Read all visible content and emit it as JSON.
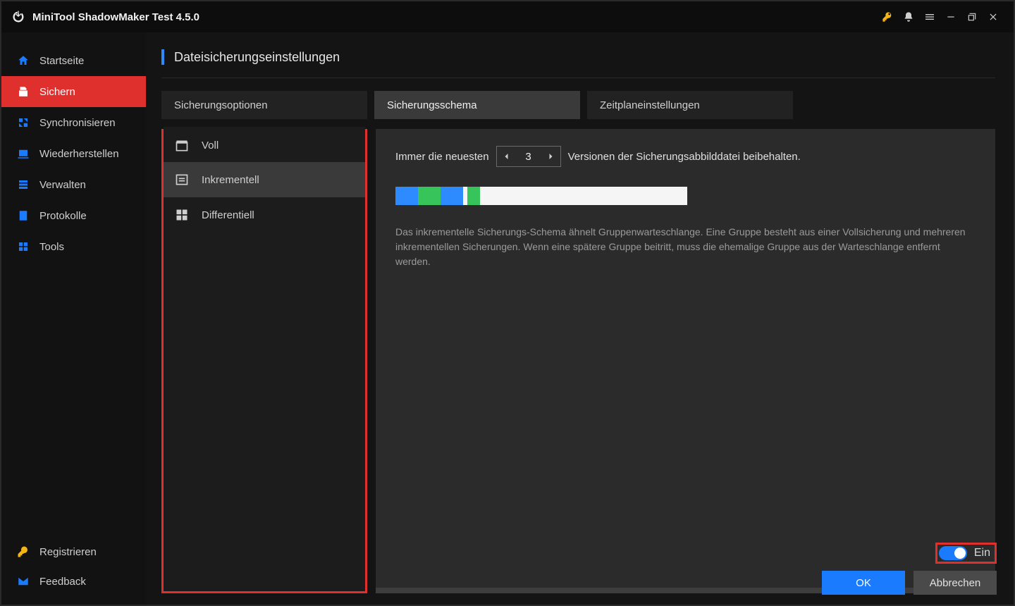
{
  "app": {
    "title": "MiniTool ShadowMaker Test 4.5.0"
  },
  "sidebar": {
    "items": [
      {
        "label": "Startseite"
      },
      {
        "label": "Sichern"
      },
      {
        "label": "Synchronisieren"
      },
      {
        "label": "Wiederherstellen"
      },
      {
        "label": "Verwalten"
      },
      {
        "label": "Protokolle"
      },
      {
        "label": "Tools"
      }
    ],
    "bottom": [
      {
        "label": "Registrieren"
      },
      {
        "label": "Feedback"
      }
    ]
  },
  "page": {
    "title": "Dateisicherungseinstellungen"
  },
  "tabs": [
    {
      "label": "Sicherungsoptionen"
    },
    {
      "label": "Sicherungsschema"
    },
    {
      "label": "Zeitplaneinstellungen"
    }
  ],
  "schemes": [
    {
      "label": "Voll"
    },
    {
      "label": "Inkrementell"
    },
    {
      "label": "Differentiell"
    }
  ],
  "detail": {
    "keep_prefix": "Immer die neuesten",
    "keep_count": "3",
    "keep_suffix": "Versionen der Sicherungsabbilddatei beibehalten.",
    "description": "Das inkrementelle Sicherungs-Schema ähnelt Gruppenwarteschlange. Eine Gruppe besteht aus einer Vollsicherung und mehreren inkrementellen Sicherungen. Wenn eine spätere Gruppe beitritt, muss die ehemalige Gruppe aus der Warteschlange entfernt werden."
  },
  "toggle": {
    "label": "Ein"
  },
  "buttons": {
    "ok": "OK",
    "cancel": "Abbrechen"
  }
}
